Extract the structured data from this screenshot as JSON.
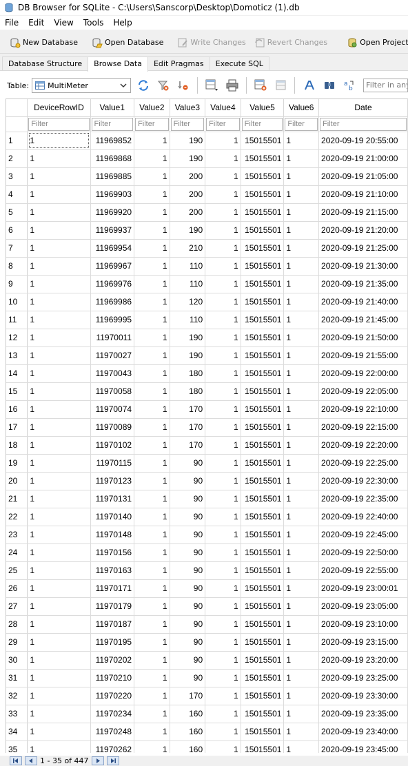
{
  "window": {
    "title": "DB Browser for SQLite - C:\\Users\\Sanscorp\\Desktop\\Domoticz (1).db"
  },
  "menubar": {
    "items": [
      "File",
      "Edit",
      "View",
      "Tools",
      "Help"
    ]
  },
  "toolbar": {
    "new_database": "New Database",
    "open_database": "Open Database",
    "write_changes": "Write Changes",
    "revert_changes": "Revert Changes",
    "open_project": "Open Project"
  },
  "tabs": [
    "Database Structure",
    "Browse Data",
    "Edit Pragmas",
    "Execute SQL"
  ],
  "browse": {
    "table_label": "Table:",
    "table_value": "MultiMeter",
    "filter_all_placeholder": "Filter in any"
  },
  "grid": {
    "columns": [
      "DeviceRowID",
      "Value1",
      "Value2",
      "Value3",
      "Value4",
      "Value5",
      "Value6",
      "Date"
    ],
    "filter_placeholder": "Filter",
    "rows": [
      [
        "1",
        "1",
        "11969852",
        "1",
        "190",
        "1",
        "15015501",
        "1",
        "2020-09-19 20:55:00"
      ],
      [
        "2",
        "1",
        "11969868",
        "1",
        "190",
        "1",
        "15015501",
        "1",
        "2020-09-19 21:00:00"
      ],
      [
        "3",
        "1",
        "11969885",
        "1",
        "200",
        "1",
        "15015501",
        "1",
        "2020-09-19 21:05:00"
      ],
      [
        "4",
        "1",
        "11969903",
        "1",
        "200",
        "1",
        "15015501",
        "1",
        "2020-09-19 21:10:00"
      ],
      [
        "5",
        "1",
        "11969920",
        "1",
        "200",
        "1",
        "15015501",
        "1",
        "2020-09-19 21:15:00"
      ],
      [
        "6",
        "1",
        "11969937",
        "1",
        "190",
        "1",
        "15015501",
        "1",
        "2020-09-19 21:20:00"
      ],
      [
        "7",
        "1",
        "11969954",
        "1",
        "210",
        "1",
        "15015501",
        "1",
        "2020-09-19 21:25:00"
      ],
      [
        "8",
        "1",
        "11969967",
        "1",
        "110",
        "1",
        "15015501",
        "1",
        "2020-09-19 21:30:00"
      ],
      [
        "9",
        "1",
        "11969976",
        "1",
        "110",
        "1",
        "15015501",
        "1",
        "2020-09-19 21:35:00"
      ],
      [
        "10",
        "1",
        "11969986",
        "1",
        "120",
        "1",
        "15015501",
        "1",
        "2020-09-19 21:40:00"
      ],
      [
        "11",
        "1",
        "11969995",
        "1",
        "110",
        "1",
        "15015501",
        "1",
        "2020-09-19 21:45:00"
      ],
      [
        "12",
        "1",
        "11970011",
        "1",
        "190",
        "1",
        "15015501",
        "1",
        "2020-09-19 21:50:00"
      ],
      [
        "13",
        "1",
        "11970027",
        "1",
        "190",
        "1",
        "15015501",
        "1",
        "2020-09-19 21:55:00"
      ],
      [
        "14",
        "1",
        "11970043",
        "1",
        "180",
        "1",
        "15015501",
        "1",
        "2020-09-19 22:00:00"
      ],
      [
        "15",
        "1",
        "11970058",
        "1",
        "180",
        "1",
        "15015501",
        "1",
        "2020-09-19 22:05:00"
      ],
      [
        "16",
        "1",
        "11970074",
        "1",
        "170",
        "1",
        "15015501",
        "1",
        "2020-09-19 22:10:00"
      ],
      [
        "17",
        "1",
        "11970089",
        "1",
        "170",
        "1",
        "15015501",
        "1",
        "2020-09-19 22:15:00"
      ],
      [
        "18",
        "1",
        "11970102",
        "1",
        "170",
        "1",
        "15015501",
        "1",
        "2020-09-19 22:20:00"
      ],
      [
        "19",
        "1",
        "11970115",
        "1",
        "90",
        "1",
        "15015501",
        "1",
        "2020-09-19 22:25:00"
      ],
      [
        "20",
        "1",
        "11970123",
        "1",
        "90",
        "1",
        "15015501",
        "1",
        "2020-09-19 22:30:00"
      ],
      [
        "21",
        "1",
        "11970131",
        "1",
        "90",
        "1",
        "15015501",
        "1",
        "2020-09-19 22:35:00"
      ],
      [
        "22",
        "1",
        "11970140",
        "1",
        "90",
        "1",
        "15015501",
        "1",
        "2020-09-19 22:40:00"
      ],
      [
        "23",
        "1",
        "11970148",
        "1",
        "90",
        "1",
        "15015501",
        "1",
        "2020-09-19 22:45:00"
      ],
      [
        "24",
        "1",
        "11970156",
        "1",
        "90",
        "1",
        "15015501",
        "1",
        "2020-09-19 22:50:00"
      ],
      [
        "25",
        "1",
        "11970163",
        "1",
        "90",
        "1",
        "15015501",
        "1",
        "2020-09-19 22:55:00"
      ],
      [
        "26",
        "1",
        "11970171",
        "1",
        "90",
        "1",
        "15015501",
        "1",
        "2020-09-19 23:00:01"
      ],
      [
        "27",
        "1",
        "11970179",
        "1",
        "90",
        "1",
        "15015501",
        "1",
        "2020-09-19 23:05:00"
      ],
      [
        "28",
        "1",
        "11970187",
        "1",
        "90",
        "1",
        "15015501",
        "1",
        "2020-09-19 23:10:00"
      ],
      [
        "29",
        "1",
        "11970195",
        "1",
        "90",
        "1",
        "15015501",
        "1",
        "2020-09-19 23:15:00"
      ],
      [
        "30",
        "1",
        "11970202",
        "1",
        "90",
        "1",
        "15015501",
        "1",
        "2020-09-19 23:20:00"
      ],
      [
        "31",
        "1",
        "11970210",
        "1",
        "90",
        "1",
        "15015501",
        "1",
        "2020-09-19 23:25:00"
      ],
      [
        "32",
        "1",
        "11970220",
        "1",
        "170",
        "1",
        "15015501",
        "1",
        "2020-09-19 23:30:00"
      ],
      [
        "33",
        "1",
        "11970234",
        "1",
        "160",
        "1",
        "15015501",
        "1",
        "2020-09-19 23:35:00"
      ],
      [
        "34",
        "1",
        "11970248",
        "1",
        "160",
        "1",
        "15015501",
        "1",
        "2020-09-19 23:40:00"
      ],
      [
        "35",
        "1",
        "11970262",
        "1",
        "160",
        "1",
        "15015501",
        "1",
        "2020-09-19 23:45:00"
      ]
    ]
  },
  "status": {
    "position_text": "1 - 35 of 447"
  }
}
